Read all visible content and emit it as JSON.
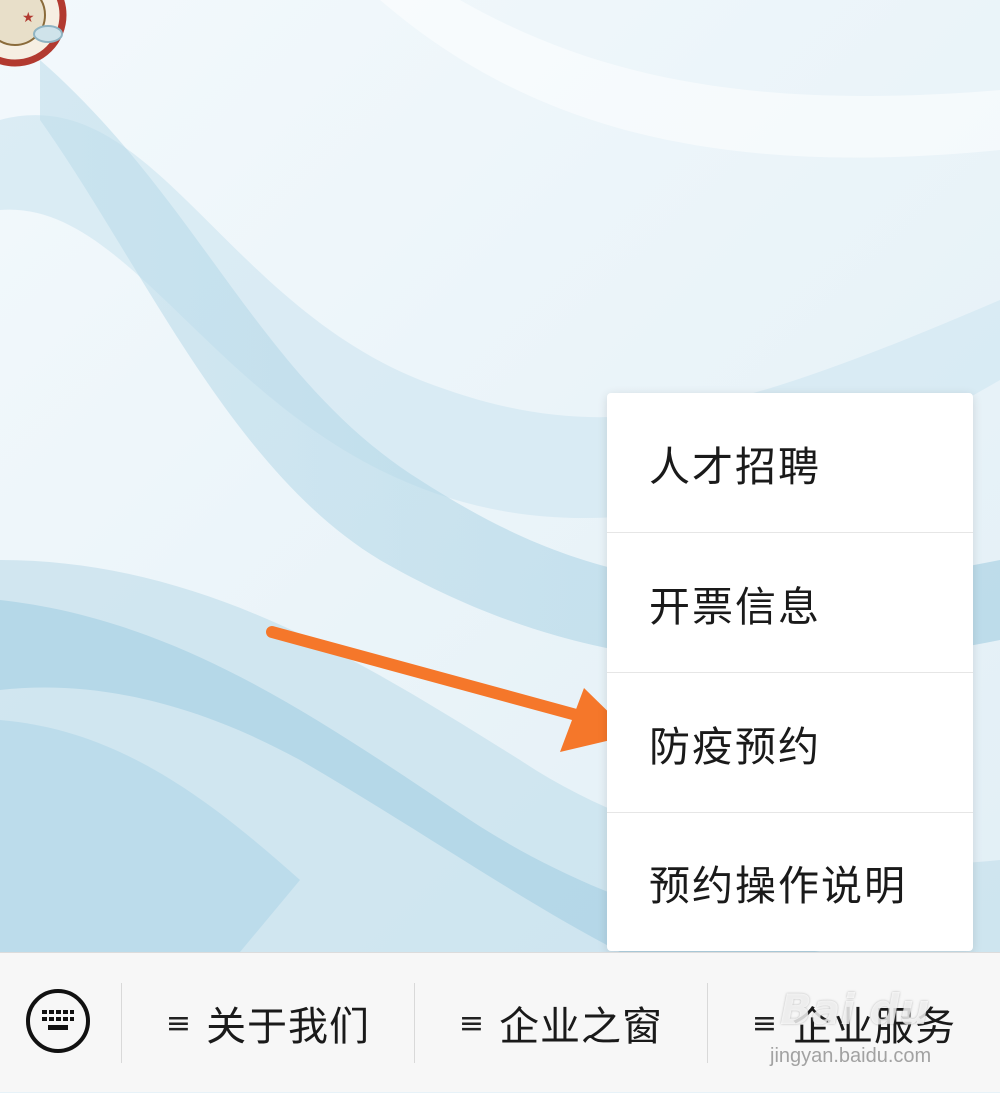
{
  "menu": {
    "items": [
      {
        "label": "人才招聘"
      },
      {
        "label": "开票信息"
      },
      {
        "label": "防疫预约"
      },
      {
        "label": "预约操作说明"
      }
    ]
  },
  "bottom_bar": {
    "keyboard_icon": "keyboard-icon",
    "tabs": [
      {
        "icon": "≡",
        "label": "关于我们"
      },
      {
        "icon": "≡",
        "label": "企业之窗"
      },
      {
        "icon": "≡",
        "label": "企业服务"
      }
    ]
  },
  "annotation": {
    "arrow_color": "#f5772a"
  },
  "watermark": {
    "logo": "Bai du",
    "url": "jingyan.baidu.com"
  }
}
